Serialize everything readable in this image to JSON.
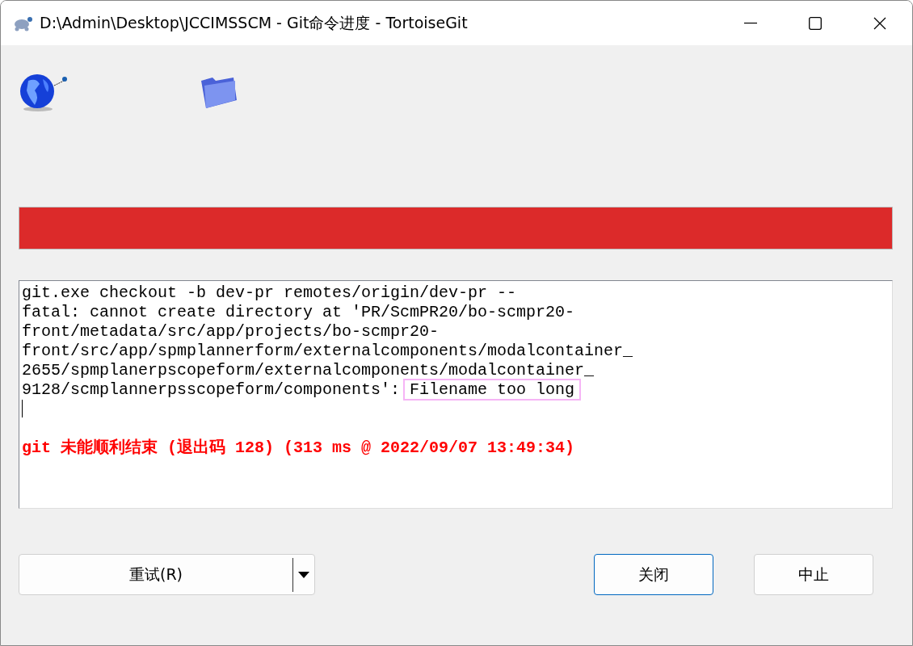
{
  "window": {
    "title": "D:\\Admin\\Desktop\\JCCIMSSCM - Git命令进度 - TortoiseGit"
  },
  "progress": {
    "level": 1
  },
  "log": [
    {
      "kind": "normal",
      "segments": [
        {
          "text": "git.exe checkout -b dev-pr remotes/origin/dev-pr --",
          "highlighted": false
        }
      ]
    },
    {
      "kind": "normal",
      "segments": [
        {
          "text": "fatal: cannot create directory at 'PR/ScmPR20/bo-scmpr20-",
          "highlighted": false
        }
      ]
    },
    {
      "kind": "normal",
      "segments": [
        {
          "text": "front/metadata/src/app/projects/bo-scmpr20-",
          "highlighted": false
        }
      ]
    },
    {
      "kind": "normal",
      "segments": [
        {
          "text": "front/src/app/spmplannerform/externalcomponents/modalcontainer_",
          "highlighted": false
        }
      ]
    },
    {
      "kind": "normal",
      "segments": [
        {
          "text": "2655/spmplanerpscopeform/externalcomponents/modalcontainer_",
          "highlighted": false
        }
      ]
    },
    {
      "kind": "normal",
      "segments": [
        {
          "text": "9128/scmplannerpsscopeform/components':",
          "highlighted": false
        },
        {
          "text": "Filename too long",
          "highlighted": true
        }
      ]
    },
    {
      "kind": "cursor"
    },
    {
      "kind": "blank"
    },
    {
      "kind": "error",
      "segments": [
        {
          "text": "git 未能顺利结束 (退出码 128) (313 ms @ 2022/09/07 13:49:34)",
          "highlighted": false
        }
      ]
    }
  ],
  "buttons": [
    {
      "label": "重试(R)",
      "kind": "split",
      "default": false
    },
    {
      "label": "关闭",
      "kind": "plain",
      "default": true
    },
    {
      "label": "中止",
      "kind": "plain",
      "default": false
    }
  ]
}
